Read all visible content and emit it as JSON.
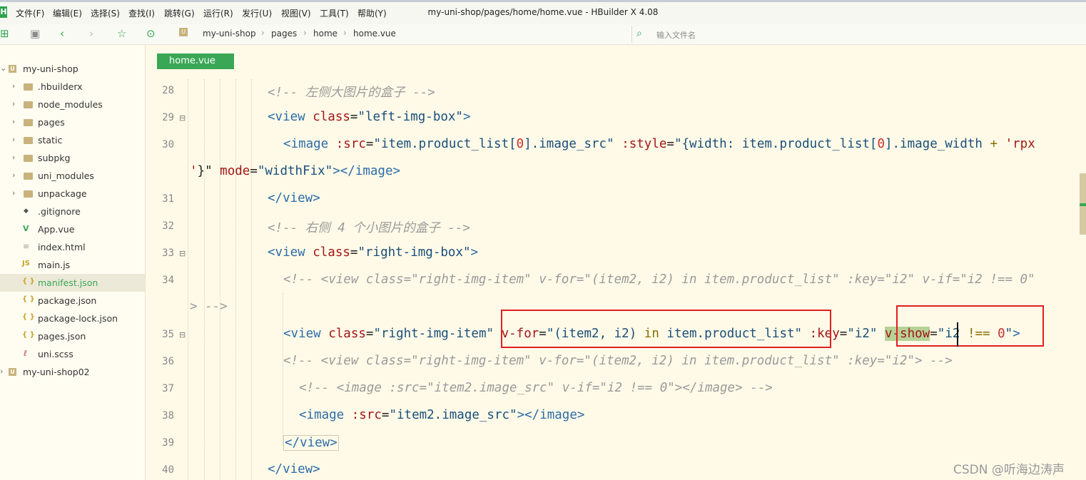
{
  "menubar": {
    "logo": "H",
    "items": [
      "文件(F)",
      "编辑(E)",
      "选择(S)",
      "查找(I)",
      "跳转(G)",
      "运行(R)",
      "发行(U)",
      "视图(V)",
      "工具(T)",
      "帮助(Y)"
    ],
    "title": "my-uni-shop/pages/home/home.vue - HBuilder X 4.08"
  },
  "toolbar": {
    "icons": [
      "new-file-icon",
      "save-icon",
      "back-icon",
      "forward-icon",
      "star-icon",
      "run-icon"
    ],
    "breadcrumb": [
      "my-uni-shop",
      "pages",
      "home",
      "home.vue"
    ],
    "file_search_placeholder": "输入文件名"
  },
  "sidebar": {
    "items": [
      {
        "label": "my-uni-shop",
        "type": "project",
        "arrow": "⌄"
      },
      {
        "label": ".hbuilderx",
        "type": "folder",
        "arrow": "›"
      },
      {
        "label": "node_modules",
        "type": "folder",
        "arrow": "›"
      },
      {
        "label": "pages",
        "type": "folder",
        "arrow": "›"
      },
      {
        "label": "static",
        "type": "folder",
        "arrow": "›"
      },
      {
        "label": "subpkg",
        "type": "folder",
        "arrow": "›"
      },
      {
        "label": "uni_modules",
        "type": "folder",
        "arrow": "›"
      },
      {
        "label": "unpackage",
        "type": "folder",
        "arrow": "›"
      },
      {
        "label": ".gitignore",
        "type": "file",
        "icon": "◆"
      },
      {
        "label": "App.vue",
        "type": "file",
        "icon": "V"
      },
      {
        "label": "index.html",
        "type": "file",
        "icon": "≡"
      },
      {
        "label": "main.js",
        "type": "file",
        "icon": "JS"
      },
      {
        "label": "manifest.json",
        "type": "file",
        "icon": "{ }"
      },
      {
        "label": "package.json",
        "type": "file",
        "icon": "{ }"
      },
      {
        "label": "package-lock.json",
        "type": "file",
        "icon": "{ }"
      },
      {
        "label": "pages.json",
        "type": "file",
        "icon": "{ }"
      },
      {
        "label": "uni.scss",
        "type": "file",
        "icon": "ℓ"
      },
      {
        "label": "my-uni-shop02",
        "type": "project",
        "arrow": "›"
      }
    ]
  },
  "editor": {
    "tab": "home.vue",
    "line_numbers": [
      "28",
      "29",
      "30",
      "",
      "31",
      "32",
      "33",
      "34",
      "",
      "35",
      "36",
      "37",
      "38",
      "39",
      "40"
    ],
    "code": [
      "<!-- 左侧大图片的盒子 -->",
      "<view class=\"left-img-box\">",
      "<image :src=\"item.product_list[0].image_src\" :style=\"{width: item.product_list[0].image_width + 'rpx",
      "'}\" mode=\"widthFix\"></image>",
      "</view>",
      "<!-- 右侧 4 个小图片的盒子 -->",
      "<view class=\"right-img-box\">",
      "<!-- <view class=\"right-img-item\" v-for=\"(item2, i2) in item.product_list\" :key=\"i2\" v-if=\"i2 !== 0\"",
      "> -->",
      "<view class=\"right-img-item\" v-for=\"(item2, i2) in item.product_list\" :key=\"i2\" v-show=\"i2 !== 0\">",
      "<!-- <view class=\"right-img-item\" v-for=\"(item2, i2) in item.product_list\" :key=\"i2\"> -->",
      "<!-- <image :src=\"item2.image_src\" v-if=\"i2 !== 0\"></image> -->",
      "<image :src=\"item2.image_src\"></image>",
      "</view>",
      "</view>"
    ]
  },
  "watermark": "CSDN @听海边涛声",
  "colors": {
    "accent": "#3aa757",
    "highlight_box": "#e02020",
    "editor_bg": "#fffae8"
  }
}
